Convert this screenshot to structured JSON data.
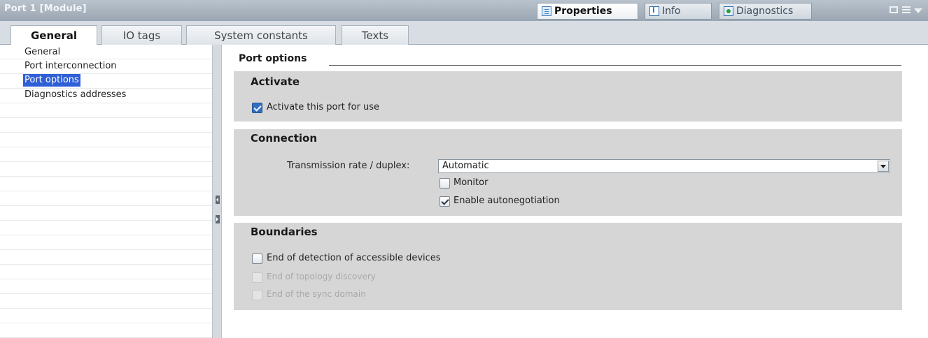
{
  "window": {
    "title": "Port 1 [Module]"
  },
  "inspector_tabs": [
    {
      "label": "Properties",
      "icon": "properties-icon",
      "active": true
    },
    {
      "label": "Info",
      "icon": "info-icon",
      "active": false
    },
    {
      "label": "Diagnostics",
      "icon": "diagnostics-icon",
      "active": false
    }
  ],
  "tabs": [
    {
      "label": "General",
      "active": true
    },
    {
      "label": "IO tags",
      "active": false
    },
    {
      "label": "System constants",
      "active": false
    },
    {
      "label": "Texts",
      "active": false
    }
  ],
  "nav": {
    "items": [
      {
        "label": "General",
        "selected": false
      },
      {
        "label": "Port interconnection",
        "selected": false
      },
      {
        "label": "Port options",
        "selected": true
      },
      {
        "label": "Diagnostics addresses",
        "selected": false
      }
    ]
  },
  "content": {
    "section_title": "Port options",
    "activate": {
      "title": "Activate",
      "checkbox_label": "Activate this port for use",
      "checked": true
    },
    "connection": {
      "title": "Connection",
      "rate_label": "Transmission rate / duplex:",
      "rate_value": "Automatic",
      "monitor_label": "Monitor",
      "monitor_checked": false,
      "autoneg_label": "Enable autonegotiation",
      "autoneg_checked": true
    },
    "boundaries": {
      "title": "Boundaries",
      "end_detection_label": "End of detection of accessible devices",
      "end_topology_label": "End of topology discovery",
      "end_sync_label": "End of the sync domain"
    }
  },
  "colors": {
    "selection": "#2f5fd6",
    "group_bg": "#d6d6d6",
    "titlebar": "#9aa6b2"
  }
}
